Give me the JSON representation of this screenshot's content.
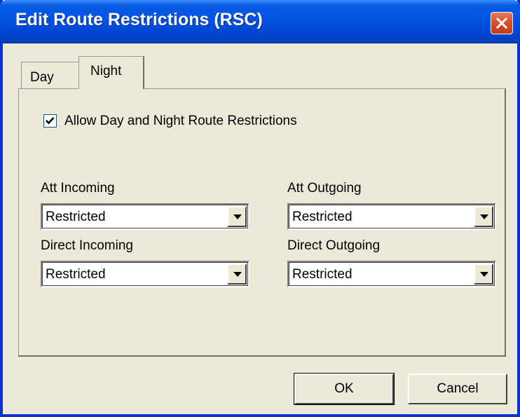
{
  "window": {
    "title": "Edit Route Restrictions (RSC)"
  },
  "tabs": [
    {
      "label": "Day",
      "selected": false
    },
    {
      "label": "Night",
      "selected": true
    }
  ],
  "checkbox": {
    "label": "Allow Day and Night Route Restrictions",
    "checked": true
  },
  "fields": {
    "att_incoming": {
      "label": "Att Incoming",
      "value": "Restricted"
    },
    "att_outgoing": {
      "label": "Att Outgoing",
      "value": "Restricted"
    },
    "direct_incoming": {
      "label": "Direct Incoming",
      "value": "Restricted"
    },
    "direct_outgoing": {
      "label": "Direct Outgoing",
      "value": "Restricted"
    }
  },
  "buttons": {
    "ok_label": "OK",
    "cancel_label": "Cancel"
  },
  "colors": {
    "titlebar_blue": "#0054e3",
    "close_red": "#d9512c",
    "dialog_face": "#ece9d8"
  },
  "icons": {
    "close": "close-icon",
    "dropdown": "dropdown-arrow-icon",
    "check": "checkmark-icon"
  }
}
